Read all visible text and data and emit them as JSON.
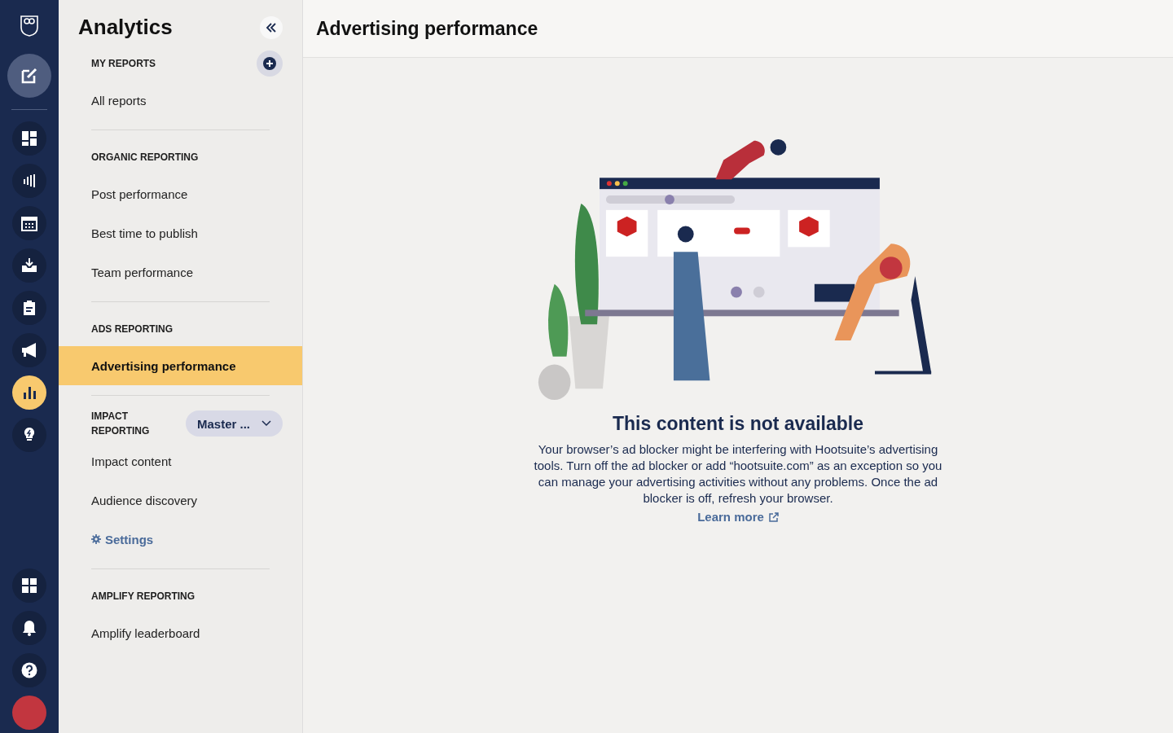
{
  "rail": {
    "compose": {
      "selected": false
    },
    "top_items": [
      {
        "kind": "dashboard",
        "selected": false
      },
      {
        "kind": "streams",
        "selected": false
      },
      {
        "kind": "calendar",
        "selected": false
      },
      {
        "kind": "inbox",
        "selected": false
      },
      {
        "kind": "clipboard",
        "selected": false
      },
      {
        "kind": "megaphone",
        "selected": false
      },
      {
        "kind": "chart",
        "selected": true
      },
      {
        "kind": "bulb",
        "selected": false
      }
    ],
    "bottom_items": [
      {
        "kind": "apps"
      },
      {
        "kind": "bell"
      },
      {
        "kind": "help"
      },
      {
        "kind": "avatar"
      }
    ]
  },
  "panel": {
    "title": "Analytics",
    "sections": [
      {
        "heading": "MY REPORTS",
        "add_button": true,
        "items": [
          {
            "label": "All reports",
            "kind": "link",
            "selected": false
          }
        ]
      },
      {
        "heading": "ORGANIC REPORTING",
        "items": [
          {
            "label": "Post performance",
            "kind": "link",
            "selected": false
          },
          {
            "label": "Best time to publish",
            "kind": "link",
            "selected": false
          },
          {
            "label": "Team performance",
            "kind": "link",
            "selected": false
          }
        ]
      },
      {
        "heading": "ADS REPORTING",
        "items": [
          {
            "label": "Advertising performance",
            "kind": "link",
            "selected": true
          }
        ]
      },
      {
        "heading": "IMPACT REPORTING",
        "dropdown": "Master ...",
        "items": [
          {
            "label": "Impact content",
            "kind": "link",
            "selected": false
          },
          {
            "label": "Audience discovery",
            "kind": "link",
            "selected": false
          },
          {
            "label": "Settings",
            "kind": "settings",
            "selected": false
          }
        ]
      },
      {
        "heading": "AMPLIFY REPORTING",
        "items": [
          {
            "label": "Amplify leaderboard",
            "kind": "link",
            "selected": false
          }
        ]
      }
    ]
  },
  "main": {
    "title": "Advertising performance",
    "message": {
      "heading": "This content is not available",
      "body": "Your browser’s ad blocker might be interfering with Hootsuite’s advertising tools. Turn off the ad blocker or add “hootsuite.com” as an exception so you can manage your advertising activities without any problems. Once the ad blocker is off, refresh your browser.",
      "link": "Learn more"
    }
  }
}
